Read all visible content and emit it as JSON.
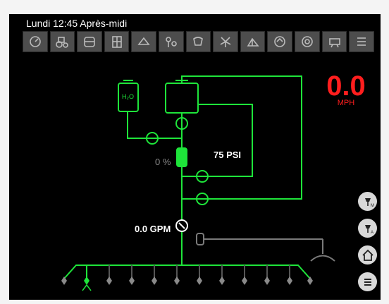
{
  "status": {
    "datetime": "Lundi 12:45 Après-midi"
  },
  "toolbar": {
    "tools": [
      {
        "icon": "gauge-icon"
      },
      {
        "icon": "tractor-icon"
      },
      {
        "icon": "tank-icon"
      },
      {
        "icon": "grid-icon"
      },
      {
        "icon": "hitch-icon"
      },
      {
        "icon": "valves-icon"
      },
      {
        "icon": "spray-icon"
      },
      {
        "icon": "fan-icon"
      },
      {
        "icon": "boom-icon"
      },
      {
        "icon": "dial-icon"
      },
      {
        "icon": "wheel-icon"
      },
      {
        "icon": "nozzle-icon"
      },
      {
        "icon": "list-icon"
      }
    ]
  },
  "speed": {
    "value": "0.0",
    "unit": "MPH"
  },
  "readouts": {
    "pressure": "75 PSI",
    "pump_percent": "0 %",
    "flow": "0.0 GPM",
    "water_tank": "H₂O"
  },
  "side_buttons": [
    {
      "icon": "nozzle-manual-icon",
      "letter": "M"
    },
    {
      "icon": "nozzle-auto-icon",
      "letter": "A"
    },
    {
      "icon": "home-icon"
    },
    {
      "icon": "menu-icon"
    }
  ],
  "colors": {
    "line": "#1ee43a",
    "speed": "#ff1e1e",
    "background": "#000000",
    "toolbar": "#4d4d4d"
  }
}
